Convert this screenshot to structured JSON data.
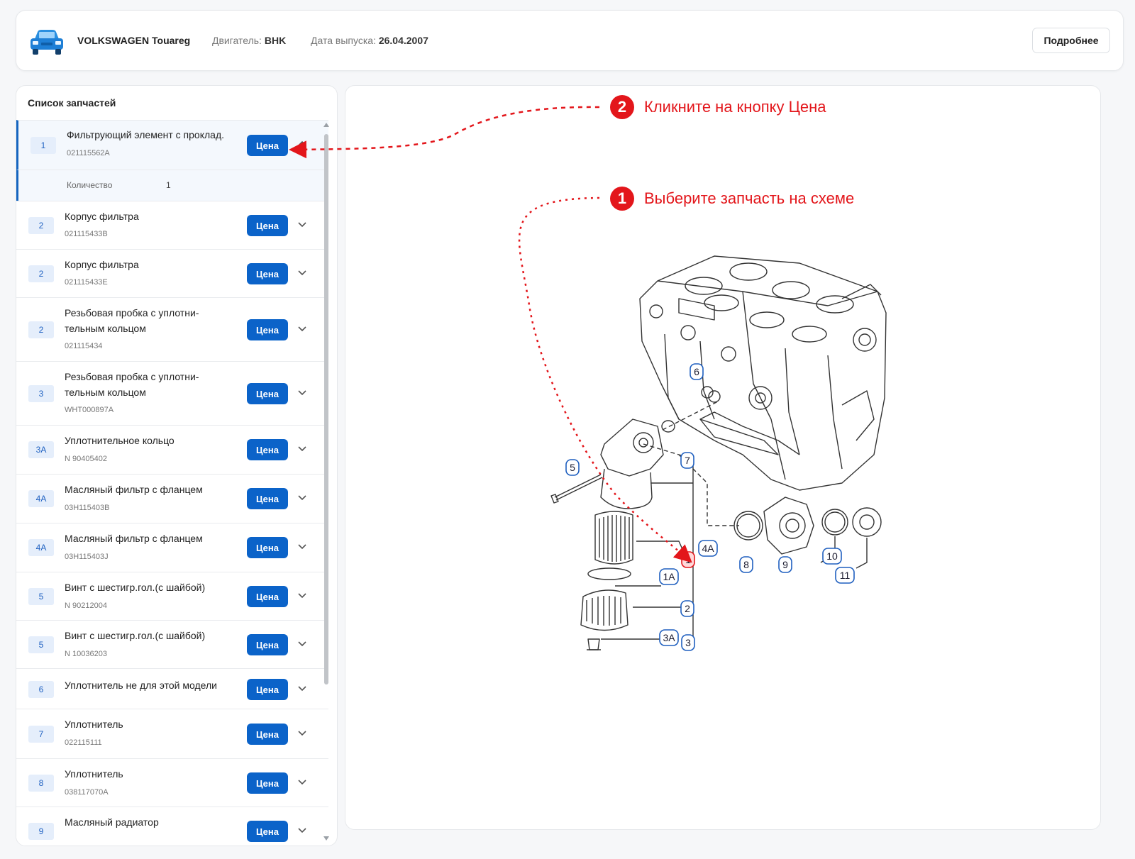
{
  "header": {
    "car_name": "VOLKSWAGEN Touareg",
    "engine_label": "Двигатель:",
    "engine_value": "BHK",
    "date_label": "Дата выпуска:",
    "date_value": "26.04.2007",
    "more_button": "Подробнее",
    "car_icon": "car-icon"
  },
  "sidebar": {
    "title": "Список запчастей",
    "price_label": "Цена",
    "qty_label": "Количество",
    "qty_value": "1",
    "items": [
      {
        "num": "1",
        "name": "Фильтрующий элемент с проклад.",
        "code": "021115562A",
        "expanded": true
      },
      {
        "num": "2",
        "name": "Корпус фильтра",
        "code": "021115433B"
      },
      {
        "num": "2",
        "name": "Корпус фильтра",
        "code": "021115433E"
      },
      {
        "num": "2",
        "name": "Резьбовая пробка с уплотни-\nтельным кольцом",
        "code": "021115434"
      },
      {
        "num": "3",
        "name": "Резьбовая пробка с уплотни-\nтельным кольцом",
        "code": "WHT000897A"
      },
      {
        "num": "3A",
        "name": "Уплотнительное кольцо",
        "code": "N 90405402"
      },
      {
        "num": "4A",
        "name": "Масляный фильтр с фланцем",
        "code": "03H115403B"
      },
      {
        "num": "4A",
        "name": "Масляный фильтр с фланцем",
        "code": "03H115403J"
      },
      {
        "num": "5",
        "name": "Винт с шестигр.гол.(с шайбой)",
        "code": "N 90212004"
      },
      {
        "num": "5",
        "name": "Винт с шестигр.гол.(с шайбой)",
        "code": "N 10036203"
      },
      {
        "num": "6",
        "name": "Уплотнитель не для этой модели",
        "code": ""
      },
      {
        "num": "7",
        "name": "Уплотнитель",
        "code": "022115111"
      },
      {
        "num": "8",
        "name": "Уплотнитель",
        "code": "038117070A"
      },
      {
        "num": "9",
        "name": "Масляный радиатор",
        "code": ""
      }
    ]
  },
  "annotations": {
    "step1_num": "1",
    "step1_text": "Выберите запчасть на схеме",
    "step2_num": "2",
    "step2_text": "Кликните на кнопку Цена",
    "accent_color": "#e3161b"
  },
  "diagram": {
    "callouts": [
      "6",
      "5",
      "7",
      "4A",
      "1",
      "1A",
      "2",
      "3A",
      "3",
      "8",
      "9",
      "10",
      "11"
    ],
    "highlighted": "1"
  }
}
